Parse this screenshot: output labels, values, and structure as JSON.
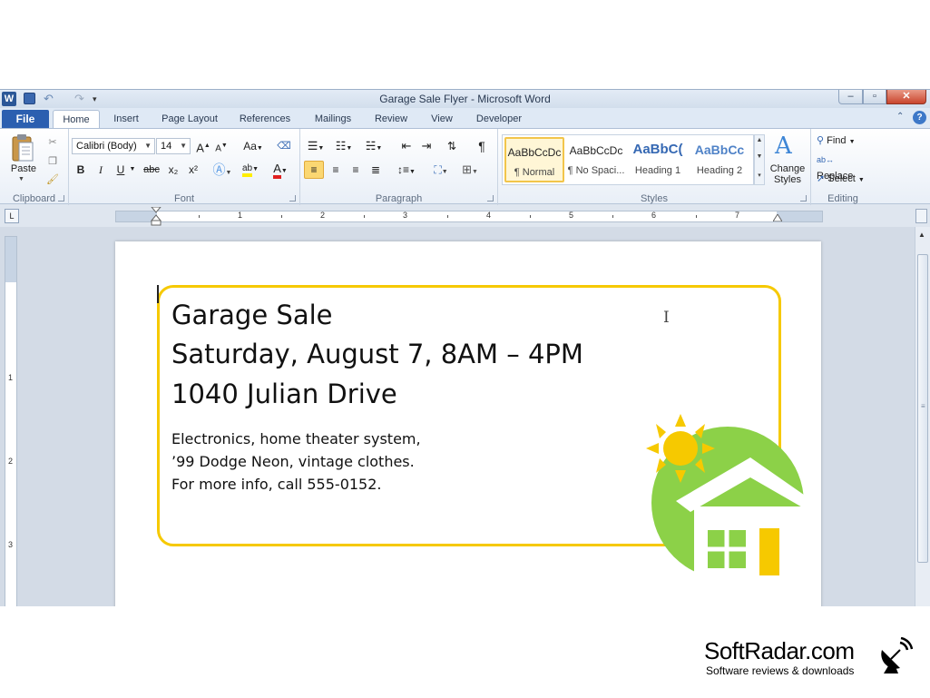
{
  "window": {
    "title": "Garage Sale Flyer - Microsoft Word",
    "qat_word_letter": "W"
  },
  "tabs": {
    "file": "File",
    "items": [
      "Home",
      "Insert",
      "Page Layout",
      "References",
      "Mailings",
      "Review",
      "View",
      "Developer"
    ],
    "active": "Home"
  },
  "ribbon": {
    "clipboard": {
      "label": "Clipboard",
      "paste": "Paste"
    },
    "font": {
      "label": "Font",
      "name": "Calibri (Body)",
      "size": "14",
      "grow": "A",
      "shrink": "A",
      "case": "Aa",
      "bold": "B",
      "italic": "I",
      "underline": "U",
      "strike": "abc",
      "subscript": "x₂",
      "superscript": "x²",
      "font_color": "A",
      "highlight": "ab"
    },
    "paragraph": {
      "label": "Paragraph"
    },
    "styles": {
      "label": "Styles",
      "items": [
        {
          "sample": "AaBbCcDc",
          "name": "¶ Normal"
        },
        {
          "sample": "AaBbCcDc",
          "name": "¶ No Spaci..."
        },
        {
          "sample": "AaBbC(",
          "name": "Heading 1"
        },
        {
          "sample": "AaBbCc",
          "name": "Heading 2"
        }
      ],
      "change_styles": "Change Styles"
    },
    "editing": {
      "label": "Editing",
      "find": "Find",
      "replace": "Replace",
      "select": "Select"
    }
  },
  "ruler": {
    "numbers": [
      "1",
      "2",
      "3",
      "4",
      "5",
      "6",
      "7"
    ],
    "vertical_numbers": [
      "1",
      "2",
      "3"
    ],
    "tab_selector": "L"
  },
  "document": {
    "lines_big": [
      "Garage Sale",
      "Saturday, August 7, 8AM – 4PM",
      "1040 Julian Drive"
    ],
    "lines_small": [
      "Electronics, home theater system,",
      "’99 Dodge Neon, vintage clothes.",
      "For more info, call 555-0152."
    ]
  },
  "colors": {
    "frame": "#f6c900",
    "sun": "#f6c900",
    "green": "#8cd148",
    "file_tab": "#2b5fb0"
  },
  "watermark": {
    "name": "SoftRadar.com",
    "tagline": "Software reviews & downloads"
  }
}
